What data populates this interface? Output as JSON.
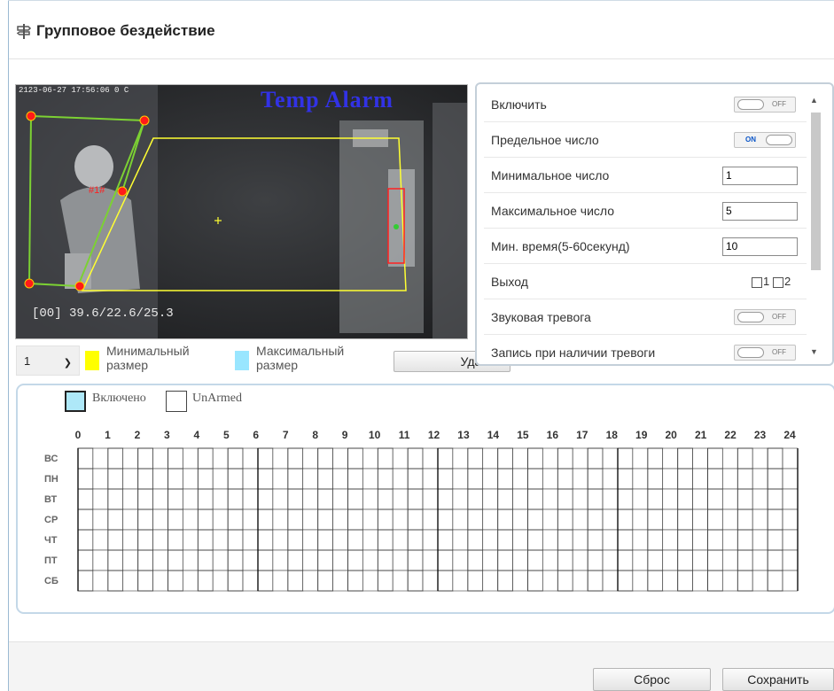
{
  "header": {
    "title": "Групповое бездействие",
    "icon": "signpost-icon"
  },
  "video": {
    "timestamp": "2123-06-27 17:56:06 0 C",
    "alarm_text": "Temp Alarm",
    "temperature_readout": "[00] 39.6/22.6/25.3",
    "region_label": "#1#",
    "colors": {
      "min_region": "#7cd133",
      "detect_region": "#ffff33",
      "alarm_box": "#ff2020",
      "handle": "#ff1a1a"
    }
  },
  "region_select": {
    "value": "1"
  },
  "legend": {
    "min_label": "Минимальный размер",
    "min_color": "#ffff00",
    "max_label": "Максимальный размер",
    "max_color": "#99e6ff"
  },
  "delete_button": "Удалить",
  "settings": {
    "enable": {
      "label": "Включить",
      "state": "OFF"
    },
    "threshold": {
      "label": "Предельное число",
      "state": "ON"
    },
    "min_count": {
      "label": "Минимальное число",
      "value": "1"
    },
    "max_count": {
      "label": "Максимальное число",
      "value": "5"
    },
    "min_time": {
      "label": "Мин. время(5-60секунд)",
      "value": "10"
    },
    "output": {
      "label": "Выход",
      "opt1": "1",
      "opt2": "2"
    },
    "audio_alarm": {
      "label": "Звуковая тревога",
      "state": "OFF"
    },
    "record_on_alarm": {
      "label": "Запись при наличии тревоги",
      "state": "OFF"
    }
  },
  "schedule": {
    "legend_armed": "Включено",
    "legend_unarmed": "UnArmed",
    "armed_color": "#aee8f8",
    "hours": [
      "0",
      "1",
      "2",
      "3",
      "4",
      "5",
      "6",
      "7",
      "8",
      "9",
      "10",
      "11",
      "12",
      "13",
      "14",
      "15",
      "16",
      "17",
      "18",
      "19",
      "20",
      "21",
      "22",
      "23",
      "24"
    ],
    "days": [
      "ВС",
      "ПН",
      "ВТ",
      "СР",
      "ЧТ",
      "ПТ",
      "СБ"
    ]
  },
  "footer": {
    "reset": "Сброс",
    "save": "Сохранить"
  }
}
